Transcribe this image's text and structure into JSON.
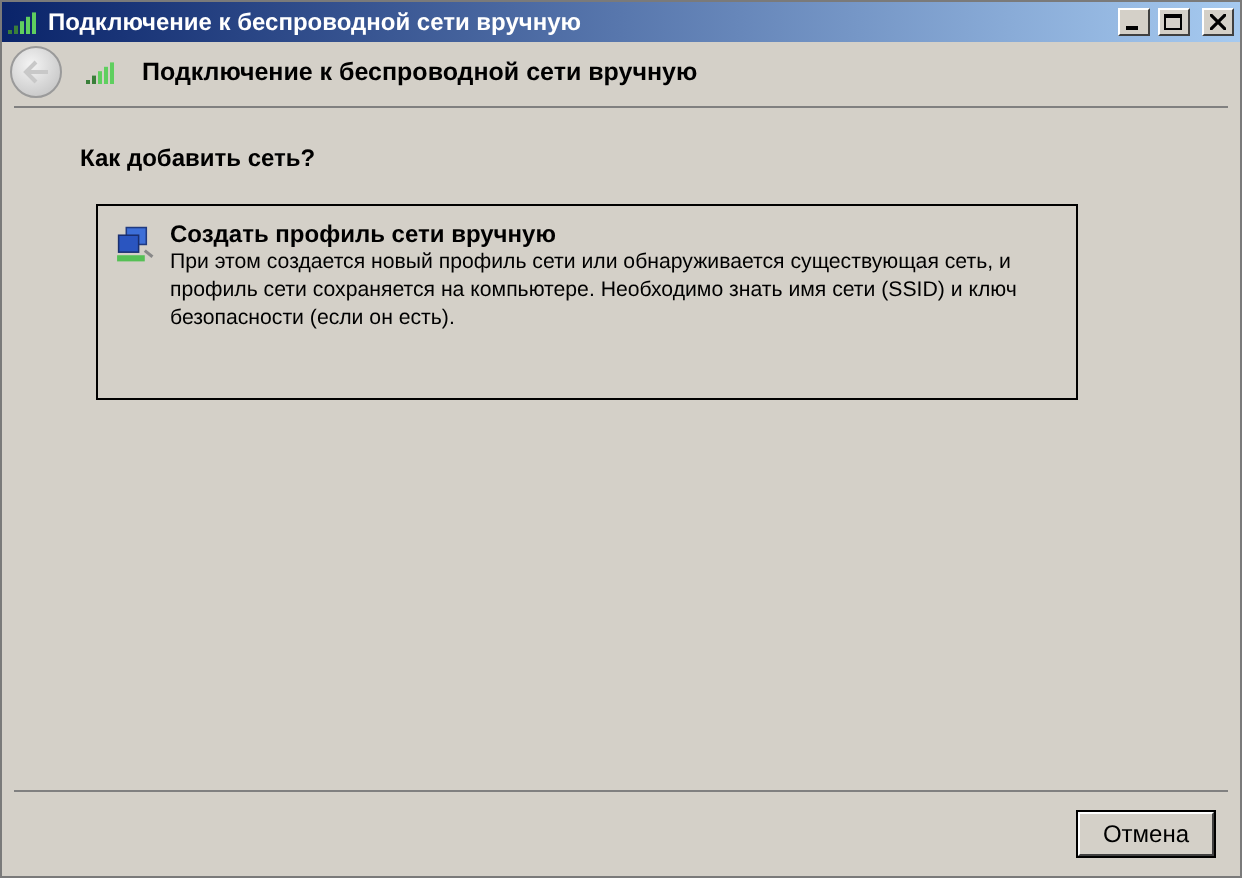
{
  "window": {
    "title": "Подключение к беспроводной сети вручную"
  },
  "header": {
    "title": "Подключение к беспроводной сети вручную"
  },
  "question": "Как добавить сеть?",
  "options": [
    {
      "title": "Создать профиль сети вручную",
      "description": "При этом создается новый профиль сети или обнаруживается существующая сеть, и профиль сети сохраняется на компьютере. Необходимо знать имя сети (SSID) и ключ безопасности (если он есть)."
    }
  ],
  "buttons": [
    {
      "label": "Отмена"
    }
  ]
}
